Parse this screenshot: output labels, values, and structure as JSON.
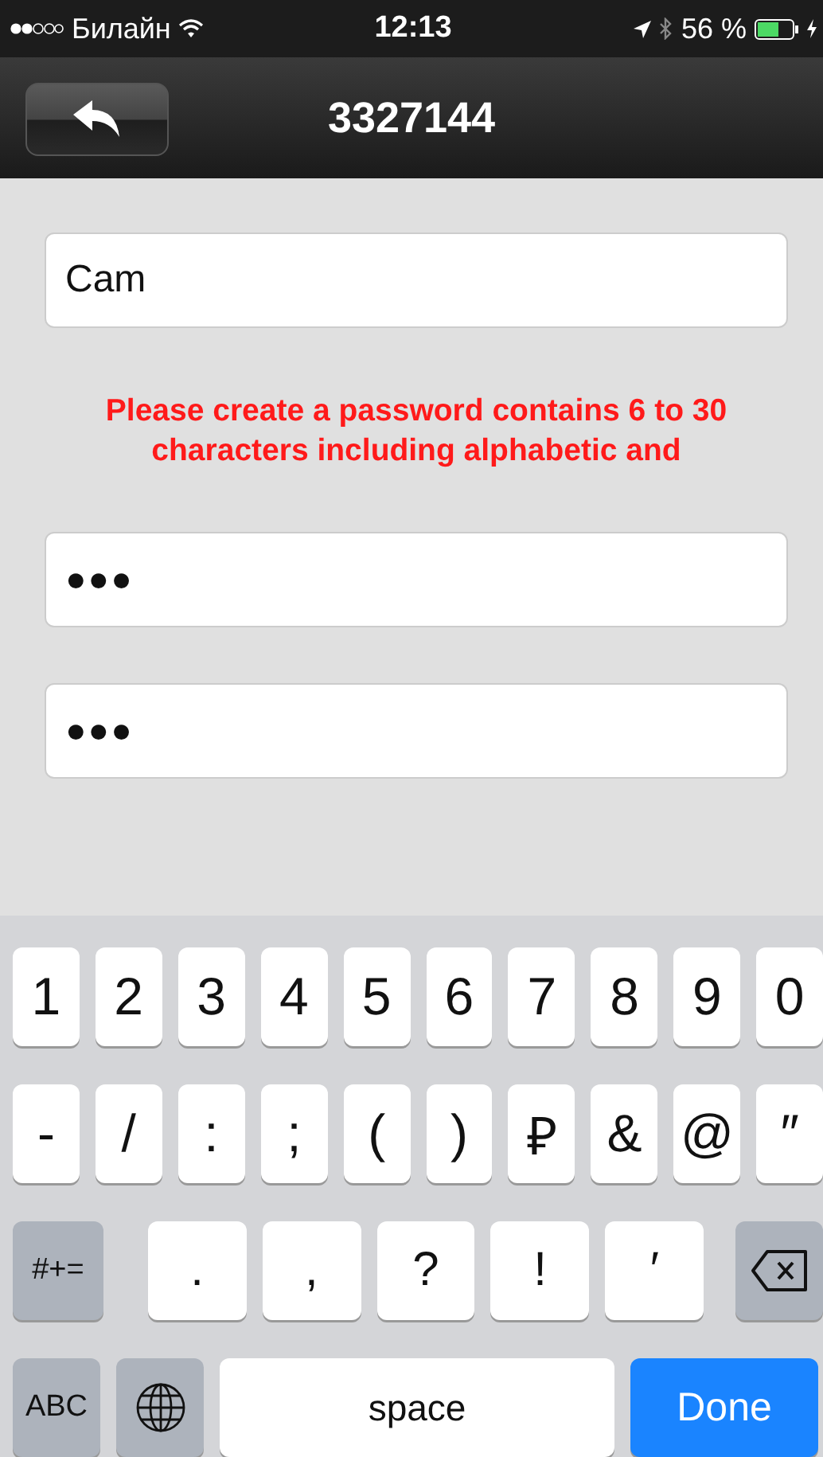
{
  "status_bar": {
    "carrier": "Билайн",
    "time": "12:13",
    "battery": "56 %"
  },
  "nav_bar": {
    "title": "3327144"
  },
  "form": {
    "name_field": {
      "value": "Cam"
    },
    "message": "Please create a password contains 6 to 30 characters including alphabetic and",
    "password_fields": [
      {
        "value": "●●●"
      },
      {
        "value": "●●●"
      }
    ]
  },
  "keyboard": {
    "rows": [
      {
        "keys": [
          {
            "kind": "char",
            "label": "1"
          },
          {
            "kind": "char",
            "label": "2"
          },
          {
            "kind": "char",
            "label": "3"
          },
          {
            "kind": "char",
            "label": "4"
          },
          {
            "kind": "char",
            "label": "5"
          },
          {
            "kind": "char",
            "label": "6"
          },
          {
            "kind": "char",
            "label": "7"
          },
          {
            "kind": "char",
            "label": "8"
          },
          {
            "kind": "char",
            "label": "9"
          },
          {
            "kind": "char",
            "label": "0"
          }
        ]
      },
      {
        "keys": [
          {
            "kind": "char",
            "label": "-"
          },
          {
            "kind": "char",
            "label": "/"
          },
          {
            "kind": "char",
            "label": ":"
          },
          {
            "kind": "char",
            "label": ";"
          },
          {
            "kind": "char",
            "label": "("
          },
          {
            "kind": "char",
            "label": ")"
          },
          {
            "kind": "char",
            "label": "₽"
          },
          {
            "kind": "char",
            "label": "&"
          },
          {
            "kind": "char",
            "label": "@"
          },
          {
            "kind": "char",
            "label": "″"
          }
        ]
      },
      {
        "keys": [
          {
            "kind": "mode",
            "label": "#+="
          },
          {
            "kind": "wide",
            "label": "."
          },
          {
            "kind": "wide",
            "label": ","
          },
          {
            "kind": "wide",
            "label": "?"
          },
          {
            "kind": "wide",
            "label": "!"
          },
          {
            "kind": "wide",
            "label": "′"
          },
          {
            "kind": "delete"
          }
        ]
      },
      {
        "keys": [
          {
            "kind": "mode",
            "label": "ABC"
          },
          {
            "kind": "globe"
          },
          {
            "kind": "space",
            "label": "space"
          },
          {
            "kind": "done",
            "label": "Done"
          }
        ]
      }
    ]
  }
}
